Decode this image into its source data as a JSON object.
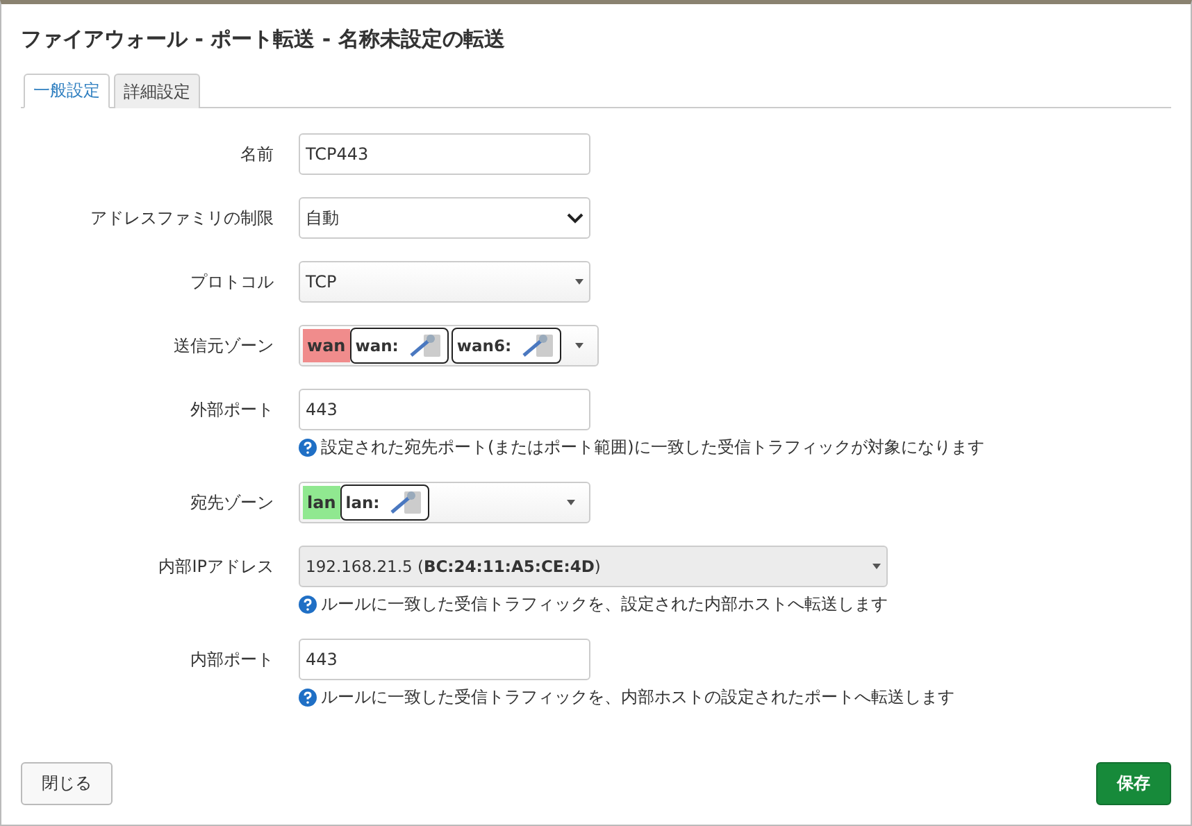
{
  "title": "ファイアウォール - ポート転送 - 名称未設定の転送",
  "tabs": [
    {
      "label": "一般設定",
      "selected": true
    },
    {
      "label": "詳細設定",
      "selected": false
    }
  ],
  "fields": [
    {
      "kind": "input",
      "label": "名前",
      "value": "TCP443"
    },
    {
      "kind": "select",
      "label": "アドレスファミリの制限",
      "value": "自動"
    },
    {
      "kind": "dropdown",
      "label": "プロトコル",
      "value": "TCP"
    },
    {
      "kind": "zone",
      "label": "送信元ゾーン",
      "zone": "wan",
      "color": "#f08c8c",
      "networks": [
        "wan:",
        "wan6:"
      ]
    },
    {
      "kind": "input",
      "label": "外部ポート",
      "value": "443",
      "help": "設定された宛先ポート(またはポート範囲)に一致した受信トラフィックが対象になります"
    },
    {
      "kind": "zone",
      "label": "宛先ゾーン",
      "zone": "lan",
      "color": "#90e890",
      "networks": [
        "lan:"
      ]
    },
    {
      "kind": "combo",
      "label": "内部IPアドレス",
      "value": "192.168.21.5 (**BC:24:11:A5:CE:4D**)",
      "help": "ルールに一致した受信トラフィックを、設定された内部ホストへ転送します"
    },
    {
      "kind": "input",
      "label": "内部ポート",
      "value": "443",
      "help": "ルールに一致した受信トラフィックを、内部ホストの設定されたポートへ転送します"
    }
  ],
  "buttons": {
    "close": "閉じる",
    "save": "保存"
  }
}
